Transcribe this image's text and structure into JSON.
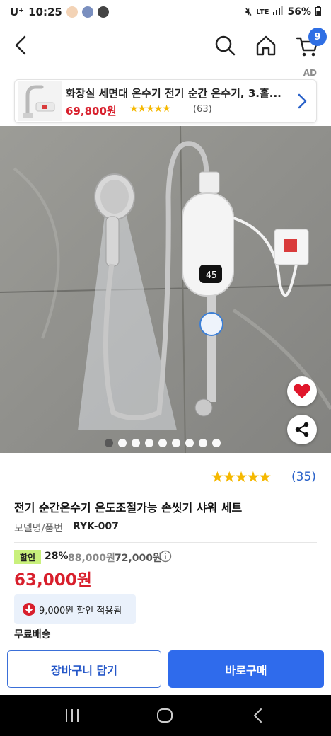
{
  "status_bar": {
    "carrier": "U⁺",
    "time": "10:25",
    "network": "LTE",
    "battery": "56%"
  },
  "nav": {
    "cart_count": "9"
  },
  "ad": {
    "label": "AD",
    "title": "화장실 세면대 온수기 전기 순간 온수기, 3.홀...",
    "price": "69,800원",
    "stars": "★★★★★",
    "review_count": "(63)"
  },
  "gallery": {
    "image_count": 9,
    "active_index": 0
  },
  "product": {
    "stars": "★★★★★",
    "rating_value": 4.5,
    "review_count": "(35)",
    "title": "전기 순간온수기 온도조절가능 손씻기 샤워 세트",
    "model_label": "모델명/품번",
    "model_value": "RYK-007",
    "sale_badge": "할인",
    "discount_rate": "28%",
    "original_price": "88,000원",
    "intermediate_price": "72,000원",
    "final_price": "63,000원",
    "coupon_text": "9,000원 할인 적용됨",
    "shipping": "무료배송"
  },
  "actions": {
    "add_to_cart": "장바구니 담기",
    "buy_now": "바로구매"
  },
  "colors": {
    "brand_blue": "#2f6bec",
    "price_red": "#d81f2c",
    "star_yellow": "#f5b800",
    "sale_green": "#c9f07c"
  }
}
